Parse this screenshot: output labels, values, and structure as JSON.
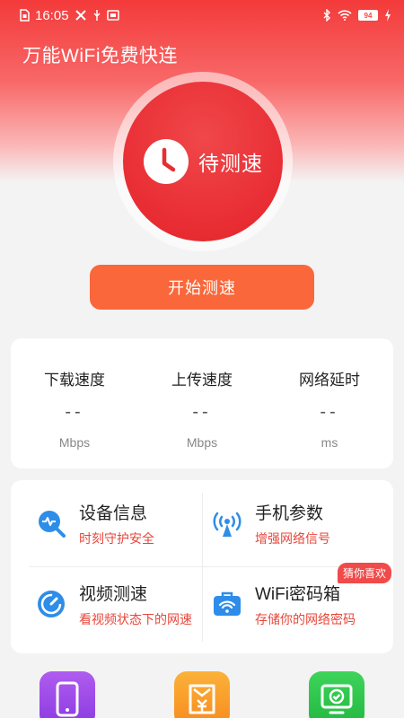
{
  "status_bar": {
    "time": "16:05",
    "battery": "94",
    "icons_left": [
      "sim-icon",
      "tools-icon",
      "usb-icon",
      "nfc-icon"
    ],
    "icons_right": [
      "bluetooth-icon",
      "wifi-icon",
      "battery-icon",
      "charging-icon"
    ]
  },
  "app": {
    "title": "万能WiFi免费快连"
  },
  "gauge": {
    "status": "待测速",
    "icon": "clock-icon"
  },
  "start_button": {
    "label": "开始测速"
  },
  "speed": [
    {
      "label": "下载速度",
      "value": "--",
      "unit": "Mbps"
    },
    {
      "label": "上传速度",
      "value": "--",
      "unit": "Mbps"
    },
    {
      "label": "网络延时",
      "value": "--",
      "unit": "ms"
    }
  ],
  "features": [
    {
      "title": "设备信息",
      "subtitle": "时刻守护安全",
      "icon": "search-pulse-icon"
    },
    {
      "title": "手机参数",
      "subtitle": "增强网络信号",
      "icon": "signal-tower-icon"
    },
    {
      "title": "视频测速",
      "subtitle": "看视频状态下的网速",
      "icon": "speedometer-icon"
    },
    {
      "title": "WiFi密码箱",
      "subtitle": "存储你的网络密码",
      "icon": "wifi-briefcase-icon"
    }
  ],
  "badge": {
    "label": "猜你喜欢"
  },
  "bottom_apps": [
    {
      "icon": "phone-icon",
      "color": "#9b45e8"
    },
    {
      "icon": "yuan-card-icon",
      "color": "#f9a02a"
    },
    {
      "icon": "monitor-check-icon",
      "color": "#2ec44a"
    }
  ],
  "colors": {
    "primary_red": "#e82d33",
    "button_orange": "#f9673a",
    "accent_blue": "#2e8de8",
    "subtitle_red": "#e8463a"
  }
}
